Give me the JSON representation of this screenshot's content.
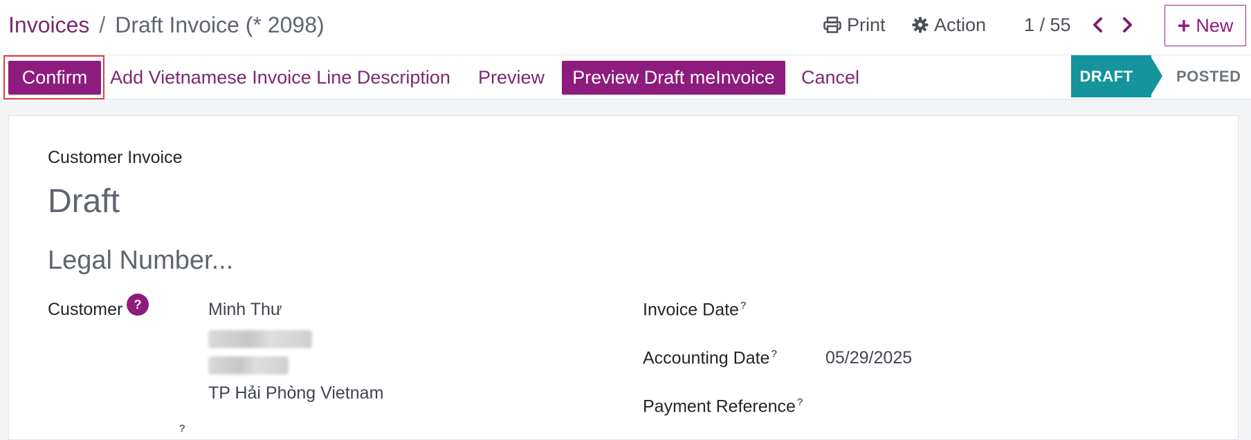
{
  "breadcrumb": {
    "root": "Invoices",
    "separator": "/",
    "current": "Draft Invoice (* 2098)"
  },
  "toolbar": {
    "print_label": "Print",
    "action_label": "Action",
    "pager": "1 / 55",
    "new_label": "New"
  },
  "actions": {
    "confirm": "Confirm",
    "add_vn_desc": "Add Vietnamese Invoice Line Description",
    "preview": "Preview",
    "preview_draft": "Preview Draft meInvoice",
    "cancel": "Cancel"
  },
  "statusbar": {
    "stages": [
      "DRAFT",
      "POSTED"
    ],
    "active": "DRAFT"
  },
  "form": {
    "type_label": "Customer Invoice",
    "title": "Draft",
    "legal_number_placeholder": "Legal Number...",
    "customer": {
      "label": "Customer",
      "help": "?",
      "name": "Minh Thư",
      "city_country": "TP Hải Phòng Vietnam"
    },
    "invoice_date": {
      "label": "Invoice Date",
      "help": "?",
      "value": ""
    },
    "accounting_date": {
      "label": "Accounting Date",
      "help": "?",
      "value": "05/29/2025"
    },
    "payment_reference": {
      "label": "Payment Reference",
      "help": "?",
      "value": ""
    },
    "cut_off_help": "?"
  },
  "colors": {
    "brand": "#8e1b7e",
    "stage_active": "#15949d",
    "highlight_frame": "#e03b3b"
  },
  "icons": {
    "print": "printer-icon",
    "action": "gear-icon",
    "prev": "chevron-left-icon",
    "next": "chevron-right-icon",
    "new": "plus-icon"
  }
}
